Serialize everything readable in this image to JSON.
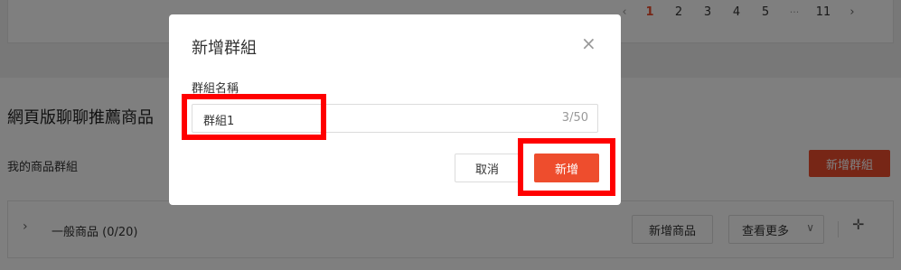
{
  "pagination": {
    "prev": "‹",
    "pages": [
      "1",
      "2",
      "3",
      "4",
      "5"
    ],
    "ellipsis": "···",
    "last": "11",
    "next": "›",
    "current": "1"
  },
  "section": {
    "title": "網頁版聊聊推薦商品",
    "group_label": "我的商品群組",
    "add_group_button": "新增群組"
  },
  "group_row": {
    "name": "一般商品 (0/20)",
    "add_product_button": "新增商品",
    "view_more_button": "查看更多"
  },
  "modal": {
    "title": "新增群組",
    "close": "×",
    "field_label": "群組名稱",
    "field_value": "群組1",
    "char_count": "3/50",
    "cancel_button": "取消",
    "submit_button": "新增"
  },
  "colors": {
    "brand": "#ee4d2d",
    "highlight": "#ff0000"
  }
}
